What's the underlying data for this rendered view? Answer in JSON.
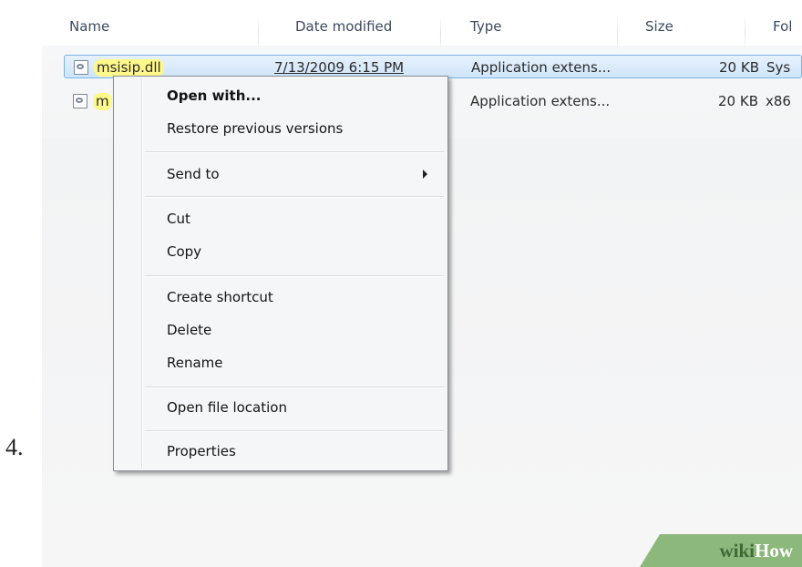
{
  "step_number": "4.",
  "columns": [
    {
      "label": "Name"
    },
    {
      "label": "Date modified"
    },
    {
      "label": "Type"
    },
    {
      "label": "Size"
    },
    {
      "label": "Fol"
    }
  ],
  "files": [
    {
      "name": "msisip.dll",
      "date": "7/13/2009 6:15 PM",
      "type": "Application extens...",
      "size": "20 KB",
      "folder": "Sys",
      "selected": true
    },
    {
      "name": "m",
      "date": "",
      "type": "Application extens...",
      "size": "20 KB",
      "folder": "x86",
      "selected": false
    }
  ],
  "context_menu": {
    "items": [
      {
        "label": "Open with...",
        "default": true
      },
      {
        "label": "Restore previous versions"
      },
      {
        "label": "Send to",
        "has_submenu": true
      },
      {
        "label": "Cut"
      },
      {
        "label": "Copy"
      },
      {
        "label": "Create shortcut"
      },
      {
        "label": "Delete"
      },
      {
        "label": "Rename"
      },
      {
        "label": "Open file location"
      },
      {
        "label": "Properties"
      }
    ]
  },
  "watermark": {
    "part1": "wiki",
    "part2": "How"
  },
  "colors": {
    "selection_border": "#7db4e8",
    "highlight": "#fff88a",
    "header_text": "#3b4a5f",
    "watermark_bg": "#8cb87c"
  }
}
